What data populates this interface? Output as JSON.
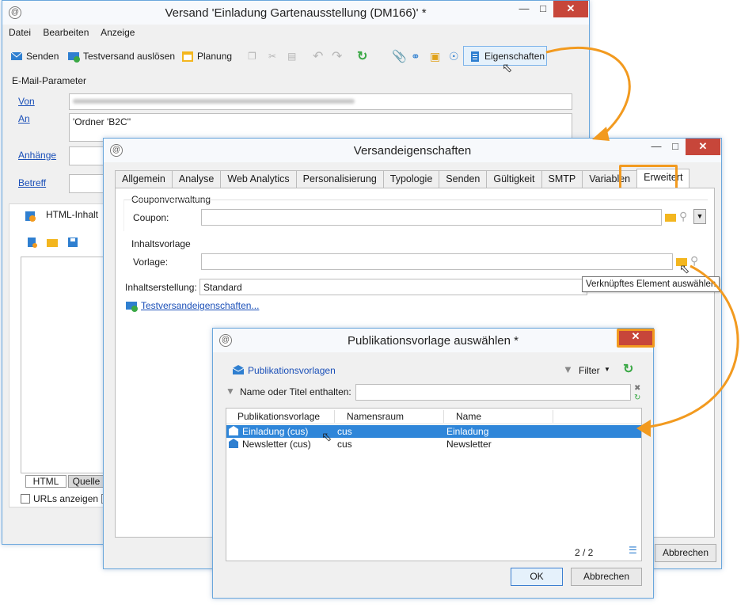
{
  "win1": {
    "title": "Versand 'Einladung Gartenausstellung (DM166)' *",
    "menu": [
      "Datei",
      "Bearbeiten",
      "Anzeige"
    ],
    "toolbar": {
      "send": "Senden",
      "test_send": "Testversand auslösen",
      "schedule": "Planung",
      "properties": "Eigenschaften"
    },
    "email_params": {
      "section": "E-Mail-Parameter",
      "from_label": "Von",
      "to_label": "An",
      "to_value": "'Ordner 'B2C''",
      "attachments_label": "Anhänge",
      "subject_label": "Betreff"
    },
    "content": {
      "title": "HTML-Inhalt",
      "tab_html": "HTML",
      "tab_source": "Quelle",
      "show_urls": "URLs anzeigen"
    }
  },
  "win2": {
    "title": "Versandeigenschaften",
    "tabs": [
      "Allgemein",
      "Analyse",
      "Web Analytics",
      "Personalisierung",
      "Typologie",
      "Senden",
      "Gültigkeit",
      "SMTP",
      "Variablen",
      "Erweitert"
    ],
    "active_tab": "Erweitert",
    "coupon_section": "Couponverwaltung",
    "coupon_label": "Coupon:",
    "template_section": "Inhaltsvorlage",
    "template_label": "Vorlage:",
    "content_creation_label": "Inhaltserstellung:",
    "content_creation_value": "Standard",
    "test_props_link": "Testversandeigenschaften...",
    "tooltip": "Verknüpftes Element auswählen",
    "cancel": "Abbrechen"
  },
  "win3": {
    "title": "Publikationsvorlage auswählen *",
    "folder": "Publikationsvorlagen",
    "filter": "Filter",
    "search_label": "Name oder Titel enthalten:",
    "columns": [
      "Publikationsvorlage",
      "Namensraum",
      "Name"
    ],
    "rows": [
      {
        "template": "Einladung (cus)",
        "namespace": "cus",
        "name": "Einladung"
      },
      {
        "template": "Newsletter (cus)",
        "namespace": "cus",
        "name": "Newsletter"
      }
    ],
    "selected_row": 0,
    "pager": "2 / 2",
    "ok": "OK",
    "cancel": "Abbrechen"
  },
  "colors": {
    "accent": "#f29a1f",
    "selection": "#2f86d9",
    "link": "#1a4fb8",
    "close": "#c7463a"
  }
}
